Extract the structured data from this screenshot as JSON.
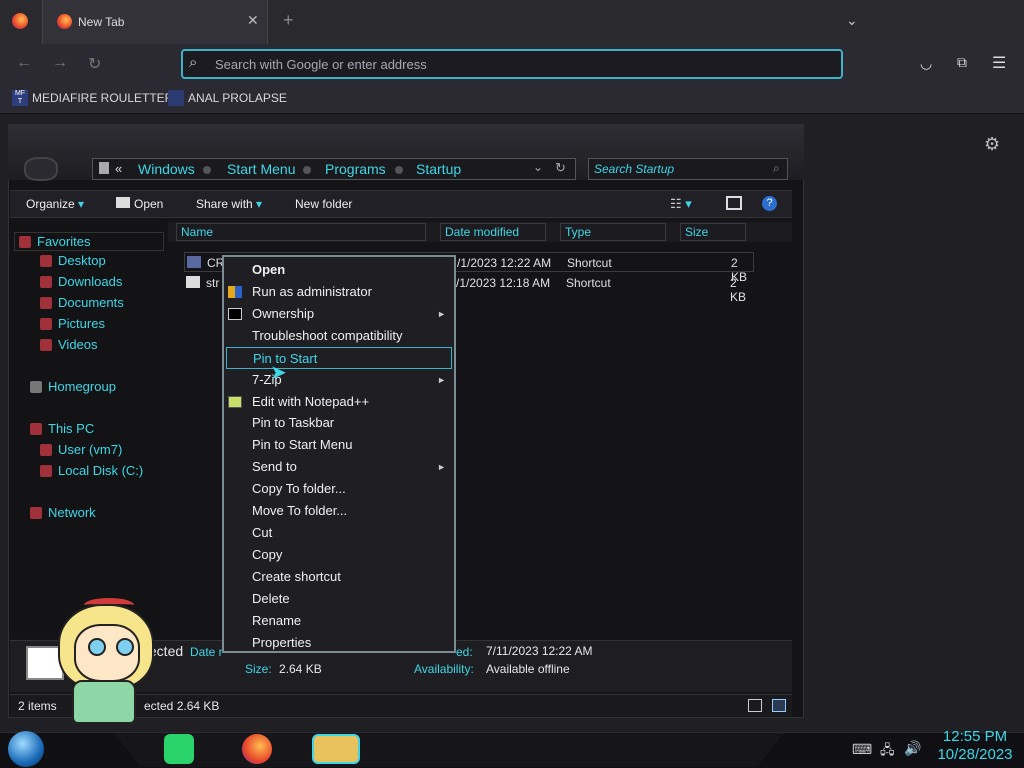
{
  "browser": {
    "tab_title": "New Tab",
    "url_placeholder": "Search with Google or enter address",
    "bookmarks": [
      {
        "label": "MEDIAFIRE ROULETTER",
        "icon": "mediafire-icon"
      },
      {
        "label": "ANAL PROLAPSE",
        "icon": "bookmark-icon"
      }
    ]
  },
  "explorer": {
    "breadcrumb": {
      "prefix": "«",
      "items": [
        "Windows",
        "Start Menu",
        "Programs",
        "Startup"
      ]
    },
    "search_placeholder": "Search Startup",
    "toolbar": {
      "organize": "Organize",
      "open": "Open",
      "share_with": "Share with",
      "new_folder": "New folder"
    },
    "nav": {
      "favorites": "Favorites",
      "favorites_items": [
        "Desktop",
        "Downloads",
        "Documents",
        "Pictures",
        "Videos"
      ],
      "homegroup": "Homegroup",
      "this_pc": "This PC",
      "this_pc_items": [
        "User (vm7)",
        "Local Disk (C:)"
      ],
      "network": "Network"
    },
    "columns": {
      "name": "Name",
      "date": "Date modified",
      "type": "Type",
      "size": "Size"
    },
    "rows": [
      {
        "name": "CR",
        "date": "/1/2023 12:22 AM",
        "type": "Shortcut",
        "size": "2 KB"
      },
      {
        "name": "str",
        "date": "/1/2023 12:18 AM",
        "type": "Shortcut",
        "size": "2 KB"
      }
    ],
    "details": {
      "selected_text": "elected",
      "date_label": "Date r",
      "modified_label": "ed:",
      "modified_value": "7/11/2023 12:22 AM",
      "size_label": "Size:",
      "size_value": "2.64 KB",
      "availability_label": "Availability:",
      "availability_value": "Available offline"
    },
    "status": {
      "items": "2 items",
      "selected": "ected  2.64 KB"
    }
  },
  "context_menu": {
    "items": [
      {
        "label": "Open",
        "bold": true
      },
      {
        "label": "Run as administrator",
        "icon": "shield-icon"
      },
      {
        "label": "Ownership",
        "icon": "cmd-icon",
        "submenu": true
      },
      {
        "label": "Troubleshoot compatibility"
      },
      {
        "label": "Pin to Start",
        "highlighted": true
      },
      {
        "label": "7-Zip",
        "submenu": true
      },
      {
        "label": "Edit with Notepad++",
        "icon": "notepad-icon"
      },
      {
        "label": "Pin to Taskbar"
      },
      {
        "label": "Pin to Start Menu"
      },
      {
        "label": "Send to",
        "submenu": true
      },
      {
        "label": "Copy To folder..."
      },
      {
        "label": "Move To folder..."
      },
      {
        "label": "Cut"
      },
      {
        "label": "Copy"
      },
      {
        "label": "Create shortcut"
      },
      {
        "label": "Delete"
      },
      {
        "label": "Rename"
      },
      {
        "label": "Properties"
      }
    ]
  },
  "taskbar": {
    "time": "12:55 PM",
    "date": "10/28/2023"
  },
  "colors": {
    "accent": "#3fd6e6",
    "menu_border": "#7a8c94"
  }
}
